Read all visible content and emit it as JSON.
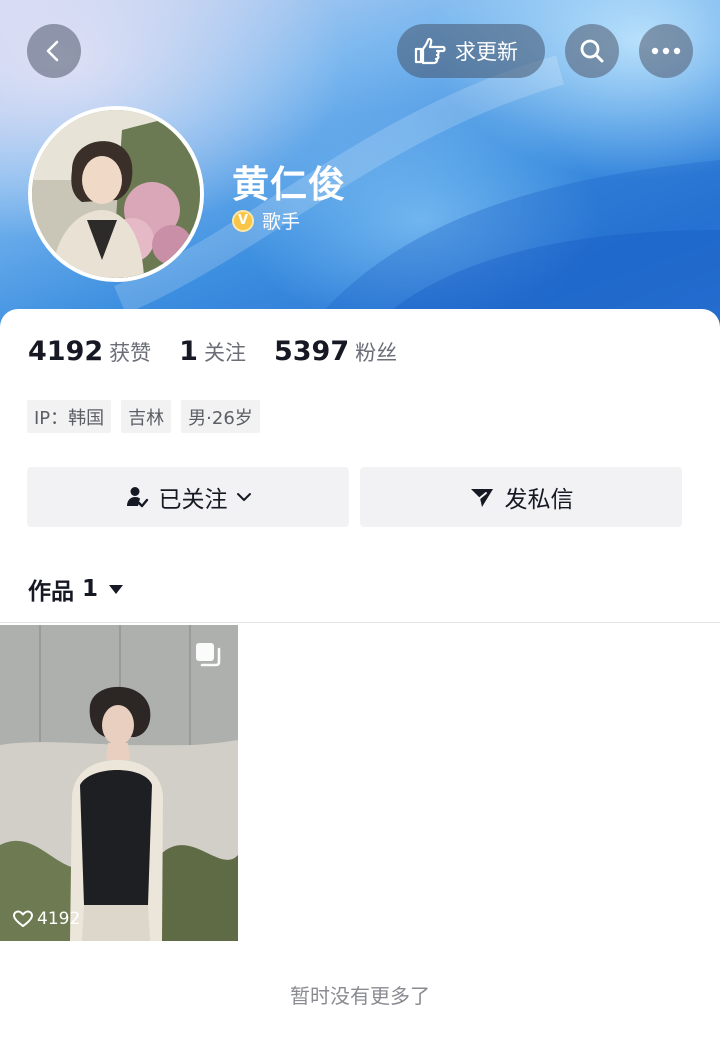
{
  "header": {
    "back_icon": "chevron-left-icon",
    "update_button": {
      "icon": "pointing-hand-icon",
      "label": "求更新"
    },
    "search_icon": "search-icon",
    "more_icon": "more-dots-icon"
  },
  "profile": {
    "name": "黄仁俊",
    "verify_badge": "V",
    "verify_label": "歌手",
    "verify_color": "#f8c546"
  },
  "stats": [
    {
      "value": "4192",
      "label": "获赞"
    },
    {
      "value": "1",
      "label": "关注"
    },
    {
      "value": "5397",
      "label": "粉丝"
    }
  ],
  "tags": [
    "IP：韩国",
    "吉林",
    "男·26岁"
  ],
  "actions": {
    "follow_label": "已关注",
    "message_label": "发私信"
  },
  "works": {
    "tab_label": "作品",
    "count": "1",
    "items": [
      {
        "likes": "4192",
        "icon": "heart-icon",
        "type_icon": "multi-image-icon"
      }
    ]
  },
  "footer": {
    "no_more": "暂时没有更多了"
  },
  "colors": {
    "accent_blue": "#2a78d6",
    "text": "#161823",
    "muted": "#6b6e77"
  }
}
